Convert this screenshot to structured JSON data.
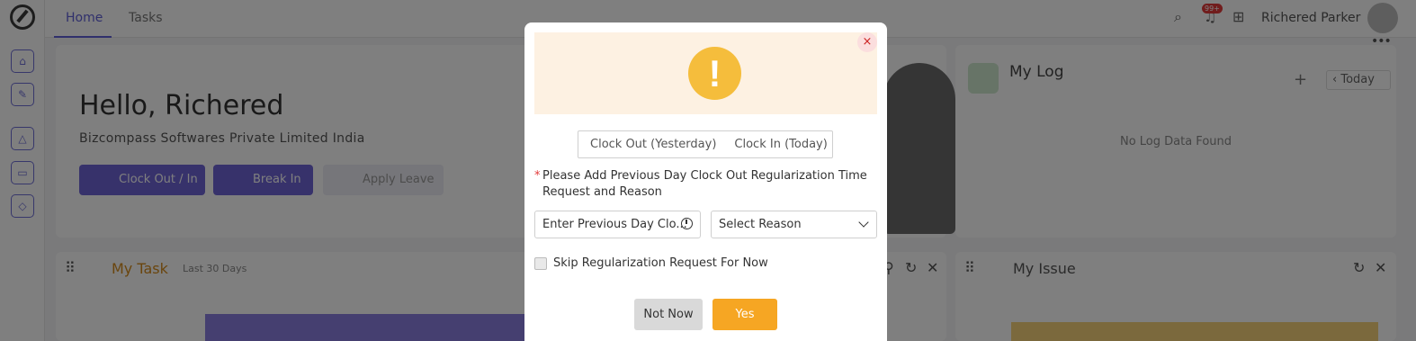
{
  "topbar": {
    "tabs": [
      "Home",
      "Tasks"
    ],
    "notification_badge": "99+",
    "user_name": "Richered Parker"
  },
  "sidebar": {
    "icons": [
      "home-icon",
      "pin-icon",
      "upload-icon",
      "calendar-icon",
      "badge-icon"
    ]
  },
  "welcome": {
    "greeting": "Hello, Richered",
    "company": "Bizcompass Softwares Private Limited India",
    "buttons": [
      "Clock Out / In",
      "Break In",
      "Apply Leave"
    ]
  },
  "my_log": {
    "title": "My Log",
    "today_label": "Today",
    "empty_text": "No Log Data Found"
  },
  "my_task": {
    "title": "My Task",
    "subtitle": "Last 30 Days"
  },
  "my_issue": {
    "title": "My Issue"
  },
  "modal": {
    "warning_symbol": "!",
    "close_symbol": "×",
    "segments": [
      "Clock Out (Yesterday)",
      "Clock In (Today)"
    ],
    "required_mark": "*",
    "prompt": "Please Add Previous Day Clock Out Regularization Time Request and Reason",
    "time_placeholder": "Enter Previous Day Clo...",
    "reason_placeholder": "Select Reason",
    "skip_label": "Skip Regularization Request For Now",
    "skip_checked": false,
    "not_now_label": "Not Now",
    "yes_label": "Yes",
    "colors": {
      "warning": "#f5bd3c",
      "warning_band": "#fdf1e2",
      "primary": "#f6a623",
      "close": "#c22222"
    }
  }
}
